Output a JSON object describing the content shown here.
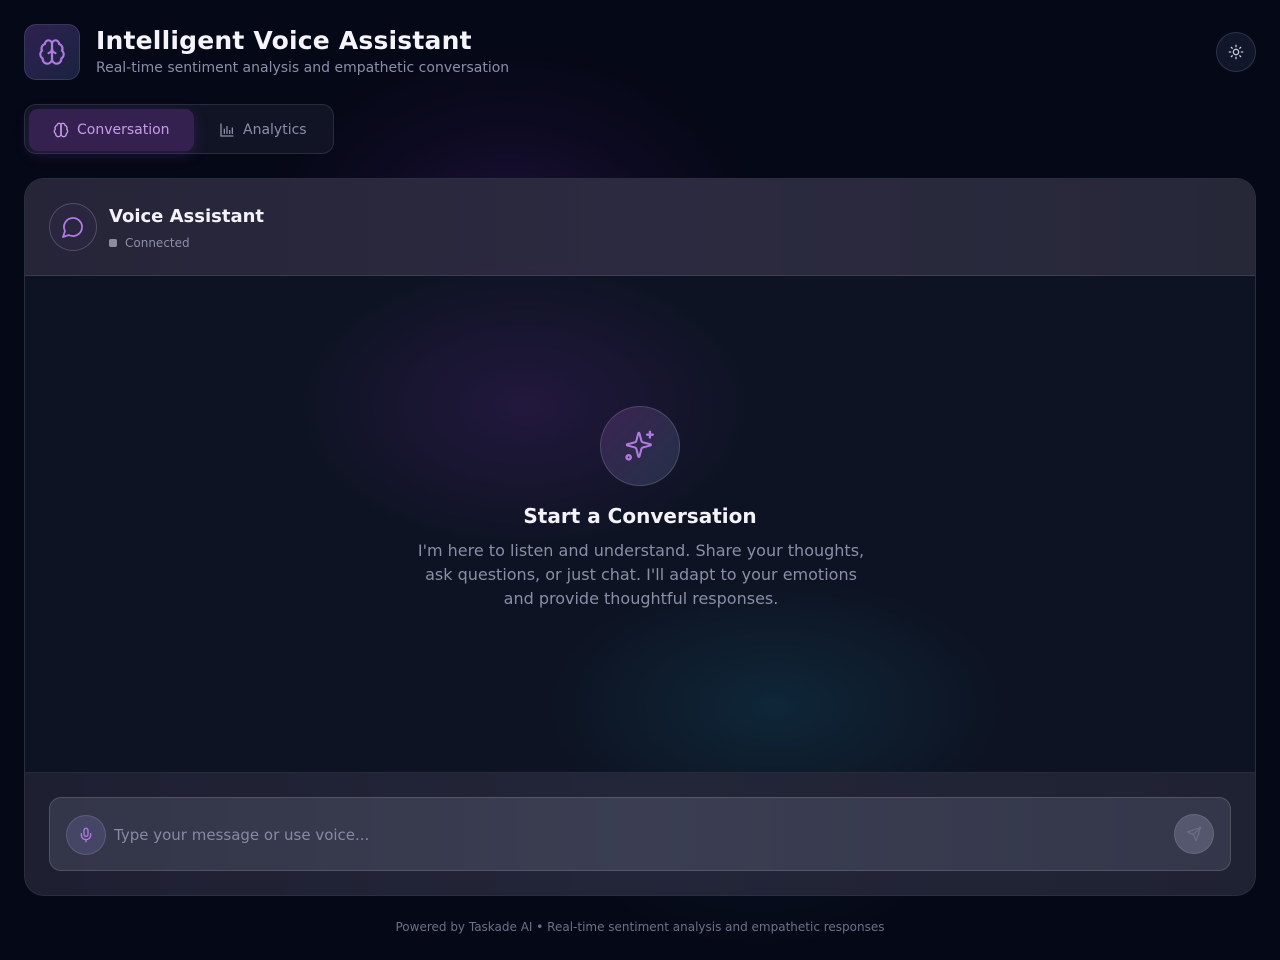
{
  "header": {
    "title": "Intelligent Voice Assistant",
    "subtitle": "Real-time sentiment analysis and empathetic conversation",
    "logo_icon": "brain-icon",
    "theme_toggle_icon": "sun-icon"
  },
  "tabs": [
    {
      "label": "Conversation",
      "icon": "brain-icon",
      "active": true
    },
    {
      "label": "Analytics",
      "icon": "bar-chart-icon",
      "active": false
    }
  ],
  "chat": {
    "assistant_name": "Voice Assistant",
    "status": "Connected",
    "avatar_icon": "message-circle-icon",
    "empty_state": {
      "icon": "sparkles-icon",
      "title": "Start a Conversation",
      "text": "I'm here to listen and understand. Share your thoughts, ask questions, or just chat. I'll adapt to your emotions and provide thoughtful responses."
    },
    "composer": {
      "placeholder": "Type your message or use voice...",
      "value": "",
      "mic_icon": "microphone-icon",
      "send_icon": "send-icon"
    }
  },
  "footer": {
    "text": "Powered by Taskade AI • Real-time sentiment analysis and empathetic responses"
  },
  "colors": {
    "background": "#050816",
    "accent": "#b07be0",
    "active_tab_bg": "#35214f"
  }
}
